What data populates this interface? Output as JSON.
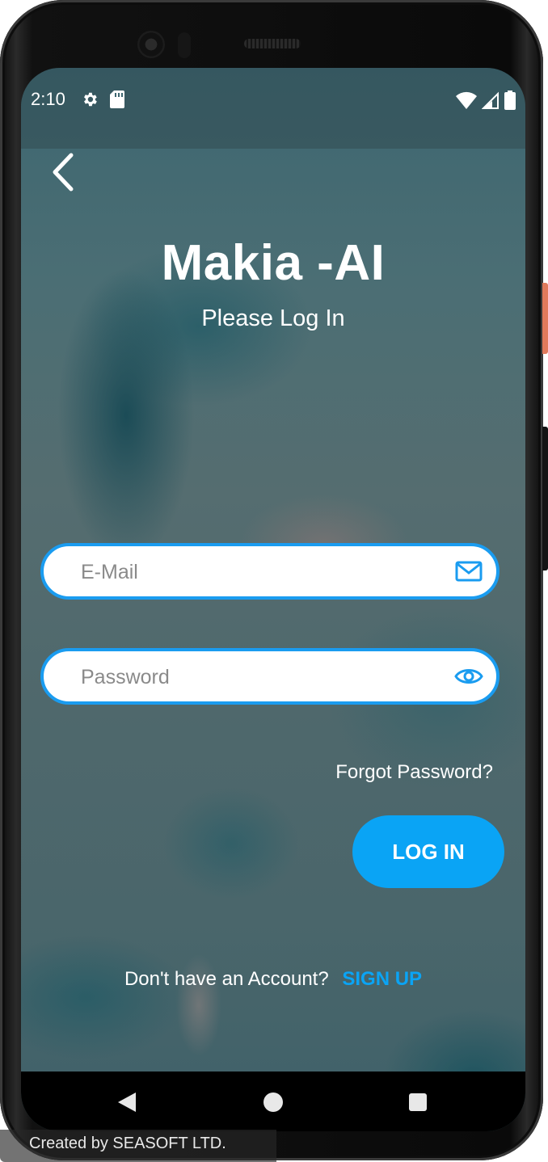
{
  "status_bar": {
    "time": "2:10",
    "left_icons": [
      "gear-icon",
      "sd-card-icon"
    ],
    "right_icons": [
      "wifi-icon",
      "signal-icon",
      "battery-icon"
    ]
  },
  "header": {
    "back_icon": "chevron-left-icon"
  },
  "app": {
    "title": "Makia -AI",
    "subtitle": "Please Log In"
  },
  "form": {
    "email": {
      "placeholder": "E-Mail",
      "value": "",
      "icon": "mail-icon"
    },
    "password": {
      "placeholder": "Password",
      "value": "",
      "icon": "eye-icon"
    },
    "forgot_password": "Forgot Password?",
    "login_button": "LOG IN",
    "signup_prompt": "Don't have an Account?",
    "signup_link": "SIGN UP"
  },
  "navbar": {
    "buttons": [
      "triangle-back-icon",
      "circle-home-icon",
      "square-recents-icon"
    ]
  },
  "watermark": "Created by SEASOFT LTD.",
  "colors": {
    "accent": "#0aa4f5",
    "field_border": "#1a9cf0",
    "text_light": "#ffffff"
  }
}
